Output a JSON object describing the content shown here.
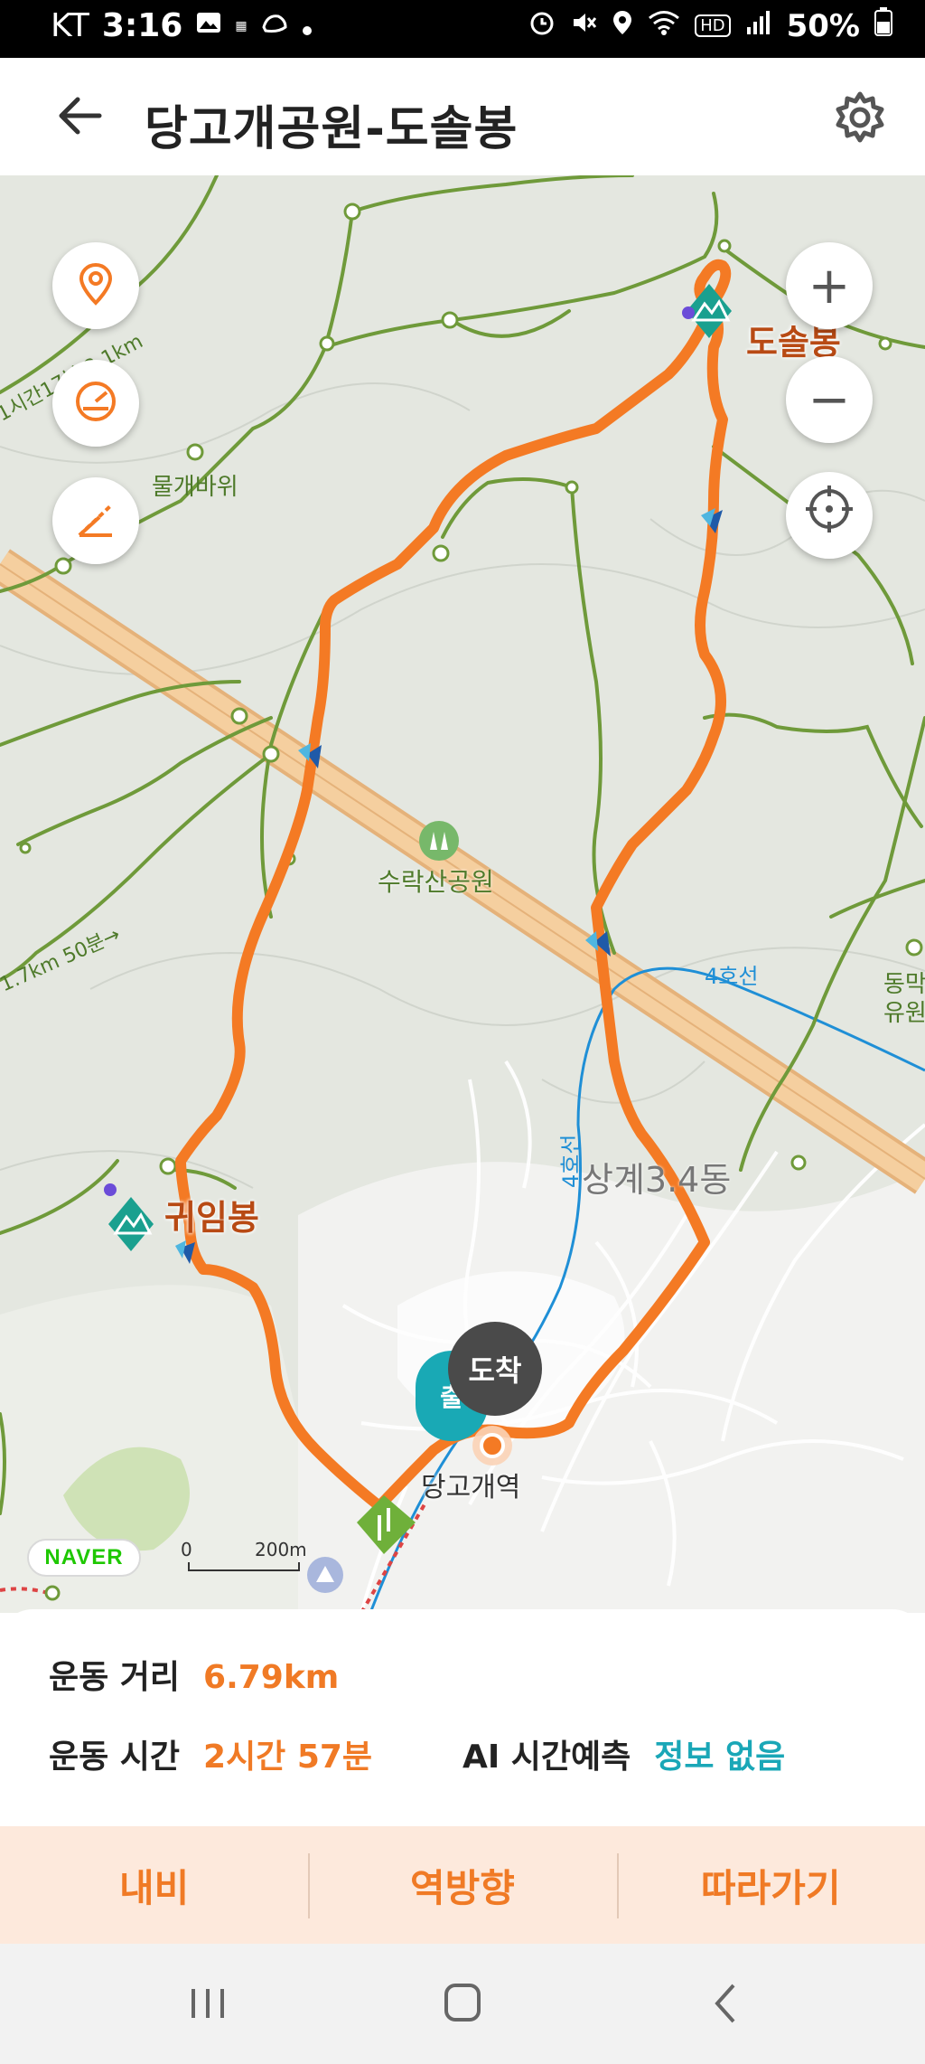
{
  "status_bar": {
    "carrier": "KT",
    "time": "3:16",
    "battery": "50%",
    "icons": [
      "gallery-icon",
      "temu-icon",
      "shoe-icon",
      "dot-icon",
      "alarm-icon",
      "mute-icon",
      "location-icon",
      "wifi-icon",
      "hd-icon",
      "signal-icon",
      "battery-icon"
    ]
  },
  "header": {
    "title": "당고개공원-도솔봉",
    "back_icon": "back-arrow-icon",
    "settings_icon": "gear-icon"
  },
  "map": {
    "labels": {
      "dosolbong": "도솔봉",
      "gwiimbong": "귀임봉",
      "mulgaebawi": "물개바위",
      "surak_park": "수락산공원",
      "line4_a": "4호선",
      "line4_b": "4호선",
      "sanggye": "상계3.4동",
      "dangogae_station": "당고개역",
      "arrive": "도착",
      "start": "출",
      "dongmak_1": "동막",
      "dongmak_2": "유원",
      "trail_top": "1시간17분 2.1km",
      "trail_left": "1.7km 50분→"
    },
    "naver": "NAVER",
    "scale_zero": "0",
    "scale_label": "200m",
    "colors": {
      "route": "#f47a24",
      "trail": "#6f9a3a",
      "highway": "#f2c58d",
      "subway": "#1f8fd6",
      "peak": "#1aa08f"
    }
  },
  "controls": {
    "left": [
      "location-pin-icon",
      "speedometer-icon",
      "slope-icon"
    ],
    "right": {
      "zoom_in": "+",
      "zoom_out": "−",
      "gps": "crosshair-icon"
    }
  },
  "info": {
    "distance_label": "운동 거리",
    "distance_value": "6.79km",
    "time_label": "운동 시간",
    "time_value": "2시간 57분",
    "ai_label": "AI 시간예측",
    "ai_value": "정보 없음"
  },
  "actions": {
    "navigate": "내비",
    "reverse": "역방향",
    "follow": "따라가기"
  },
  "system_nav": [
    "recents-icon",
    "home-icon",
    "back-icon"
  ]
}
